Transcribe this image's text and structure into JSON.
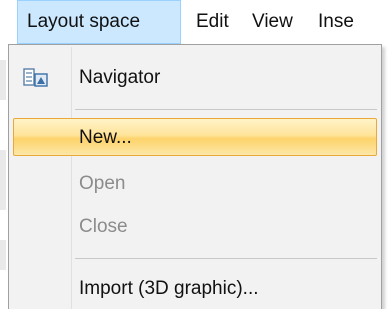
{
  "menubar": {
    "items": [
      {
        "label": "Layout space",
        "active": true
      },
      {
        "label": "Edit"
      },
      {
        "label": "View"
      },
      {
        "label": "Inse"
      }
    ]
  },
  "dropdown": {
    "items": [
      {
        "label": "Navigator",
        "icon": "navigator-icon",
        "enabled": true
      },
      {
        "label": "New...",
        "enabled": true,
        "highlighted": true
      },
      {
        "label": "Open",
        "enabled": false
      },
      {
        "label": "Close",
        "enabled": false
      },
      {
        "label": "Import (3D graphic)...",
        "enabled": true
      }
    ]
  },
  "colors": {
    "menubar_active_bg": "#cce8ff",
    "highlight_fill": "#fde49a",
    "highlight_border": "#e8a93a",
    "menu_bg": "#f2f2f2",
    "disabled_text": "#8c8c8c"
  }
}
